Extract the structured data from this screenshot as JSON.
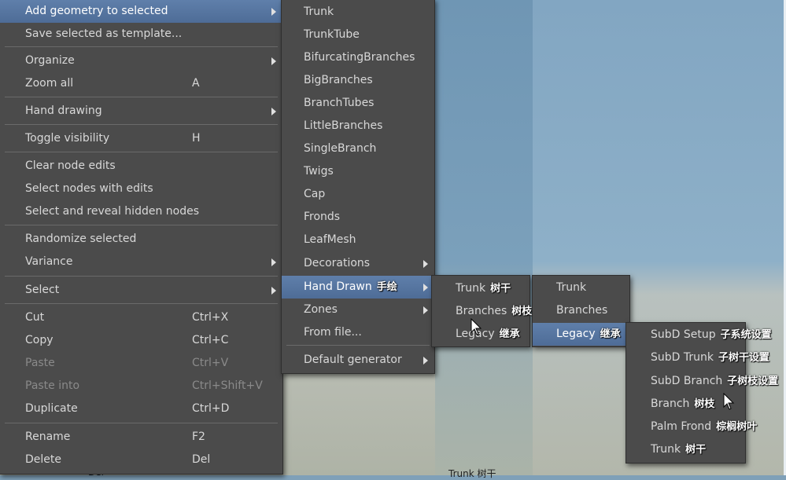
{
  "main_menu": {
    "items": [
      {
        "label": "Add geometry to selected",
        "shortcut": "",
        "submenu": true,
        "state": "highlighted"
      },
      {
        "label": "Save selected as template...",
        "shortcut": "",
        "submenu": false,
        "state": "normal"
      },
      {
        "label": "Organize",
        "shortcut": "",
        "submenu": true,
        "state": "normal"
      },
      {
        "label": "Zoom all",
        "shortcut": "A",
        "submenu": false,
        "state": "normal"
      },
      {
        "label": "Hand drawing",
        "shortcut": "",
        "submenu": true,
        "state": "normal"
      },
      {
        "label": "Toggle visibility",
        "shortcut": "H",
        "submenu": false,
        "state": "normal"
      },
      {
        "label": "Clear node edits",
        "shortcut": "",
        "submenu": false,
        "state": "normal"
      },
      {
        "label": "Select nodes with edits",
        "shortcut": "",
        "submenu": false,
        "state": "normal"
      },
      {
        "label": "Select and reveal hidden nodes",
        "shortcut": "",
        "submenu": false,
        "state": "normal"
      },
      {
        "label": "Randomize selected",
        "shortcut": "",
        "submenu": false,
        "state": "normal"
      },
      {
        "label": "Variance",
        "shortcut": "",
        "submenu": true,
        "state": "normal"
      },
      {
        "label": "Select",
        "shortcut": "",
        "submenu": true,
        "state": "normal"
      },
      {
        "label": "Cut",
        "shortcut": "Ctrl+X",
        "submenu": false,
        "state": "normal"
      },
      {
        "label": "Copy",
        "shortcut": "Ctrl+C",
        "submenu": false,
        "state": "normal"
      },
      {
        "label": "Paste",
        "shortcut": "Ctrl+V",
        "submenu": false,
        "state": "disabled"
      },
      {
        "label": "Paste into",
        "shortcut": "Ctrl+Shift+V",
        "submenu": false,
        "state": "disabled"
      },
      {
        "label": "Duplicate",
        "shortcut": "Ctrl+D",
        "submenu": false,
        "state": "normal"
      },
      {
        "label": "Rename",
        "shortcut": "F2",
        "submenu": false,
        "state": "normal"
      },
      {
        "label": "Delete",
        "shortcut": "Del",
        "submenu": false,
        "state": "normal"
      }
    ]
  },
  "geometry_menu": {
    "items": [
      {
        "label": "Trunk",
        "cn": "",
        "submenu": false,
        "state": "normal"
      },
      {
        "label": "TrunkTube",
        "cn": "",
        "submenu": false,
        "state": "normal"
      },
      {
        "label": "BifurcatingBranches",
        "cn": "",
        "submenu": false,
        "state": "normal"
      },
      {
        "label": "BigBranches",
        "cn": "",
        "submenu": false,
        "state": "normal"
      },
      {
        "label": "BranchTubes",
        "cn": "",
        "submenu": false,
        "state": "normal"
      },
      {
        "label": "LittleBranches",
        "cn": "",
        "submenu": false,
        "state": "normal"
      },
      {
        "label": "SingleBranch",
        "cn": "",
        "submenu": false,
        "state": "normal"
      },
      {
        "label": "Twigs",
        "cn": "",
        "submenu": false,
        "state": "normal"
      },
      {
        "label": "Cap",
        "cn": "",
        "submenu": false,
        "state": "normal"
      },
      {
        "label": "Fronds",
        "cn": "",
        "submenu": false,
        "state": "normal"
      },
      {
        "label": "LeafMesh",
        "cn": "",
        "submenu": false,
        "state": "normal"
      },
      {
        "label": "Decorations",
        "cn": "",
        "submenu": true,
        "state": "normal"
      },
      {
        "label": "Hand Drawn",
        "cn": "手绘",
        "submenu": true,
        "state": "highlighted"
      },
      {
        "label": "Zones",
        "cn": "",
        "submenu": true,
        "state": "normal"
      },
      {
        "label": "From file...",
        "cn": "",
        "submenu": false,
        "state": "normal"
      },
      {
        "label": "Default generator",
        "cn": "",
        "submenu": true,
        "state": "normal"
      }
    ]
  },
  "hand_drawn_menu_a": {
    "items": [
      {
        "label": "Trunk",
        "cn": "树干"
      },
      {
        "label": "Branches",
        "cn": "树枝"
      },
      {
        "label": "Legacy",
        "cn": "继承"
      }
    ]
  },
  "hand_drawn_menu_b": {
    "items": [
      {
        "label": "Trunk",
        "cn": "",
        "state": "normal"
      },
      {
        "label": "Branches",
        "cn": "",
        "state": "normal"
      },
      {
        "label": "Legacy",
        "cn": "继承",
        "state": "highlighted"
      }
    ]
  },
  "legacy_menu": {
    "items": [
      {
        "label": "SubD Setup",
        "cn": "子系统设置"
      },
      {
        "label": "SubD Trunk",
        "cn": "子树干设置"
      },
      {
        "label": "SubD Branch",
        "cn": "子树枝设置"
      },
      {
        "label": "Branch",
        "cn": "树枝"
      },
      {
        "label": "Palm Frond",
        "cn": "棕榈树叶"
      },
      {
        "label": "Trunk",
        "cn": "树干"
      }
    ]
  },
  "background_fragments": {
    "del_text": "Del",
    "trunk_text": "Trunk",
    "trunk_cn": "树干"
  }
}
